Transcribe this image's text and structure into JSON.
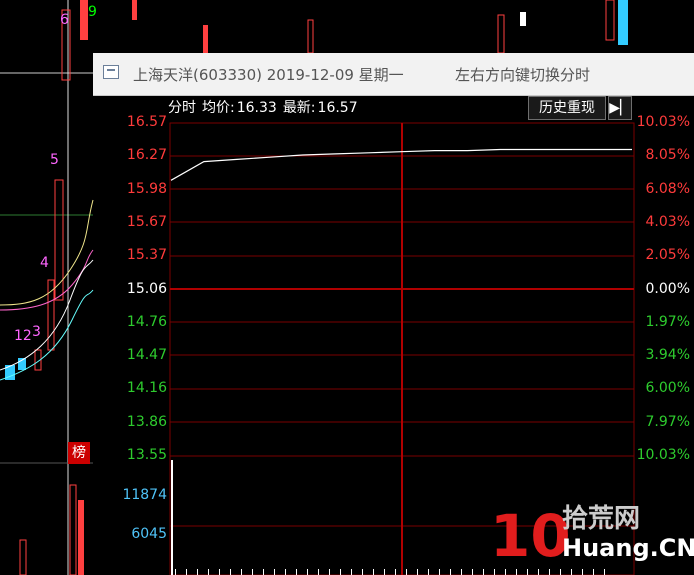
{
  "window": {
    "title": "上海天洋(603330) 2019-12-09 星期一",
    "hint": "左右方向键切换分时"
  },
  "header": {
    "mode": "分时",
    "avg_label": "均价:",
    "avg_value": "16.33",
    "last_label": "最新:",
    "last_value": "16.57",
    "history_button": "历史重现",
    "nav_icon": "arrow-right-bar-icon"
  },
  "background_chart": {
    "labels": [
      "6",
      "9",
      "5",
      "4",
      "12",
      "3",
      "榜"
    ]
  },
  "chart_data": {
    "type": "line",
    "price_axis": [
      "16.57",
      "16.27",
      "15.98",
      "15.67",
      "15.37",
      "15.06",
      "14.76",
      "14.47",
      "14.16",
      "13.86",
      "13.55"
    ],
    "pct_axis": [
      "10.03%",
      "8.05%",
      "6.08%",
      "4.03%",
      "2.05%",
      "0.00%",
      "1.97%",
      "3.94%",
      "6.00%",
      "7.97%",
      "10.03%"
    ],
    "volume_axis": [
      "11874",
      "6045"
    ],
    "prev_close": 15.06,
    "ylim": [
      13.55,
      16.57
    ],
    "series": [
      {
        "values": [
          16.05,
          16.22,
          16.24,
          16.26,
          16.28,
          16.29,
          16.3,
          16.31,
          16.32,
          16.32,
          16.33,
          16.33,
          16.33,
          16.33,
          16.33
        ]
      }
    ],
    "volume_ylim": [
      0,
      11874
    ],
    "colors": {
      "up": "#ff3b3b",
      "down": "#2ecc2e",
      "neutral": "#ffffff",
      "grid": "#7a0000",
      "volume_axis": "#4fc3f7"
    }
  },
  "watermark": {
    "brand_number": "10",
    "brand_cn": "拾荒网",
    "brand_en": "Huang.CN"
  }
}
